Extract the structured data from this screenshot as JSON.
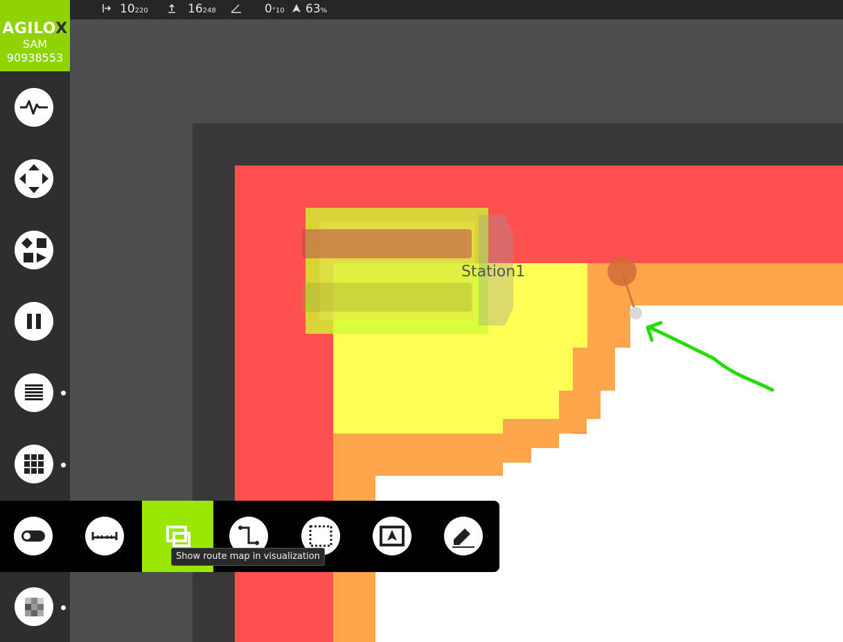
{
  "header": {
    "logo": {
      "brand_main": "AGILO",
      "brand_x": "X",
      "line1": "SAM",
      "line2": "90938553"
    },
    "stats": [
      {
        "icon": "position-x-icon",
        "value": "10",
        "sub": "220"
      },
      {
        "icon": "position-y-icon",
        "value": "16",
        "sub": "248"
      },
      {
        "icon": "angle-icon",
        "value": "0",
        "sub": "°10"
      },
      {
        "icon": "battery-arrow-icon",
        "value": "63",
        "sub": "%"
      }
    ]
  },
  "sidebar": {
    "items": [
      {
        "name": "activity-icon"
      },
      {
        "name": "move-arrows-icon"
      },
      {
        "name": "workflow-icon"
      },
      {
        "name": "pause-icon"
      },
      {
        "name": "list-icon"
      },
      {
        "name": "grid-icon"
      },
      {
        "name": "heatmap-icon"
      }
    ]
  },
  "toolbar": {
    "buttons": [
      {
        "name": "toggle-icon",
        "active": false
      },
      {
        "name": "ruler-icon",
        "active": false
      },
      {
        "name": "route-map-icon",
        "active": true
      },
      {
        "name": "route-path-icon",
        "active": false
      },
      {
        "name": "selection-frame-icon",
        "active": false
      },
      {
        "name": "navigate-frame-icon",
        "active": false
      },
      {
        "name": "eraser-icon",
        "active": false
      }
    ],
    "tooltip": "Show route map in visualization"
  },
  "map": {
    "station_label": "Station1",
    "colors": {
      "background": "#4d4d4d",
      "outer_frame": "#383838",
      "zone_red": "#ff5050",
      "zone_orange": "#ffa64d",
      "zone_yellow": "#ffff55",
      "free_space": "#ffffff",
      "station_highlight": "#ccff33",
      "annotation_arrow": "#22dd00",
      "accent": "#99e600"
    }
  }
}
